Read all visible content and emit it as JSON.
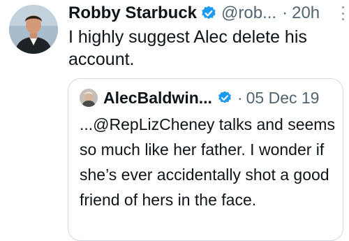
{
  "tweet": {
    "author_name": "Robby Starbuck",
    "author_handle": "@rob...",
    "separator": "·",
    "time": "20h",
    "text": "I highly suggest Alec delete his account.",
    "verified_icon": "verified-badge-icon",
    "more_icon": "more-options-icon"
  },
  "quoted_tweet": {
    "author_name": "AlecBaldwin...",
    "separator": "·",
    "date": "05 Dec 19",
    "text": "...@RepLizCheney talks and seems so much like her father. I wonder if she’s ever accidentally shot a good friend of hers in the face.",
    "verified_icon": "verified-badge-icon"
  },
  "colors": {
    "text_primary": "#0f1419",
    "text_secondary": "#536471",
    "verified_blue": "#1d9bf0",
    "border": "#cfd9de",
    "background": "#ffffff"
  }
}
